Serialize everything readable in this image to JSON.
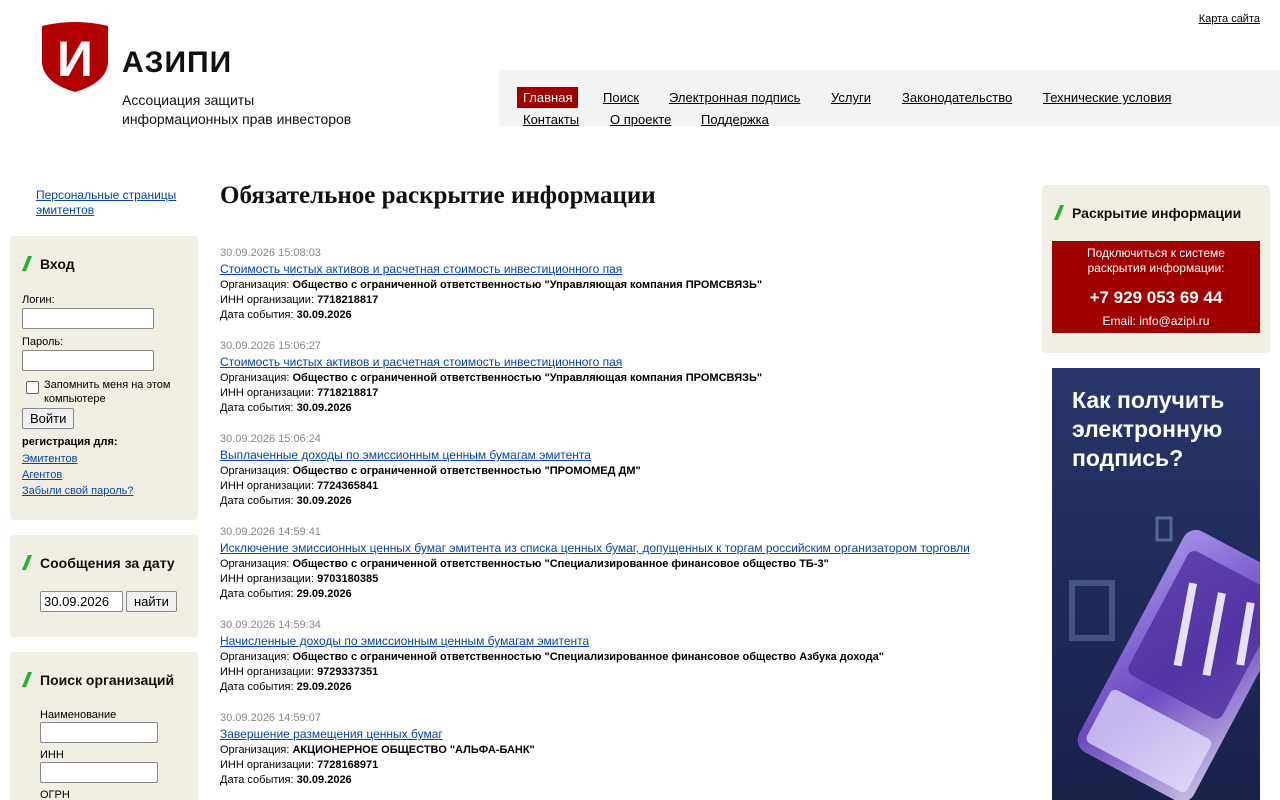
{
  "header": {
    "sitemap_label": "Карта сайта",
    "logo_letter": "И",
    "logo_name": "АЗИПИ",
    "logo_sub_line1": "Ассоциация защиты",
    "logo_sub_line2": "информационных прав инвесторов",
    "brand_color": "#a00000"
  },
  "nav": {
    "items": [
      "Главная",
      "Поиск",
      "Электронная подпись",
      "Услуги",
      "Законодательство",
      "Технические условия",
      "Контакты",
      "О проекте",
      "Поддержка"
    ],
    "active": "Главная"
  },
  "left": {
    "personal_link": "Персональные страницы эмитентов",
    "login": {
      "title": "Вход",
      "login_label": "Логин:",
      "login_value": "",
      "password_label": "Пароль:",
      "password_value": "",
      "remember_label": "Запомнить меня на этом компьютере",
      "submit": "Войти",
      "register_label": "регистрация для:",
      "reg_issuers": "Эмитентов",
      "reg_agents": "Агентов",
      "forgot": "Забыли свой пароль?"
    },
    "messages": {
      "title": "Сообщения за дату",
      "date_value": "30.09.2026",
      "submit": "найти"
    },
    "search_org": {
      "title": "Поиск организаций",
      "name_label": "Наименование",
      "inn_label": "ИНН",
      "ogrn_label": "ОГРН"
    }
  },
  "main": {
    "title": "Обязательное раскрытие информации",
    "org_label": "Организация:",
    "inn_label": "ИНН организации:",
    "date_label": "Дата события:",
    "news": [
      {
        "time": "30.09.2026 15:08:03",
        "title": "Стоимость чистых активов и расчетная стоимость инвестиционного пая",
        "org": "Общество с ограниченной ответственностью \"Управляющая компания ПРОМСВЯЗЬ\"",
        "inn": "7718218817",
        "date": "30.09.2026"
      },
      {
        "time": "30.09.2026 15:06:27",
        "title": "Стоимость чистых активов и расчетная стоимость инвестиционного пая",
        "org": "Общество с ограниченной ответственностью \"Управляющая компания ПРОМСВЯЗЬ\"",
        "inn": "7718218817",
        "date": "30.09.2026"
      },
      {
        "time": "30.09.2026 15:06:24",
        "title": "Выплаченные доходы по эмиссионным ценным бумагам эмитента",
        "org": "Общество с ограниченной ответственностью \"ПРОМОМЕД ДМ\"",
        "inn": "7724365841",
        "date": "30.09.2026"
      },
      {
        "time": "30.09.2026 14:59:41",
        "title": "Исключение эмиссионных ценных бумаг эмитента из списка ценных бумаг, допущенных к торгам российским организатором торговли",
        "org": "Общество с ограниченной ответственностью \"Специализированное финансовое общество ТБ-3\"",
        "inn": "9703180385",
        "date": "29.09.2026"
      },
      {
        "time": "30.09.2026 14:59:34",
        "title": "Начисленные доходы по эмиссионным ценным бумагам эмитента",
        "org": "Общество с ограниченной ответственностью \"Специализированное финансовое общество Азбука дохода\"",
        "inn": "9729337351",
        "date": "29.09.2026"
      },
      {
        "time": "30.09.2026 14:59:07",
        "title": "Завершение размещения ценных бумаг",
        "org": "АКЦИОНЕРНОЕ ОБЩЕСТВО \"АЛЬФА-БАНК\"",
        "inn": "7728168971",
        "date": "30.09.2026"
      }
    ]
  },
  "right": {
    "disclosure_title": "Раскрытие информации",
    "connect_line1": "Подключиться к системе",
    "connect_line2": "раскрытия информации:",
    "phone": "+7 929 053 69 44",
    "email": "Email: info@azipi.ru",
    "banner_text": "Как получить электронную подпись?"
  }
}
